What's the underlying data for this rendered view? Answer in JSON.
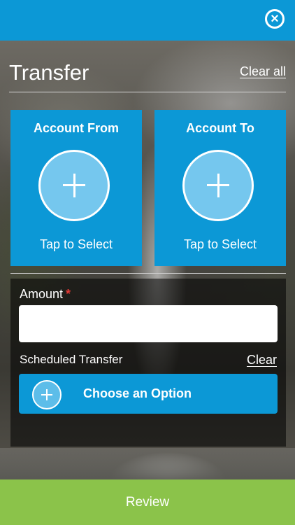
{
  "header": {
    "close_icon": "close-circle-icon",
    "accent_color": "#0c98d6"
  },
  "page": {
    "title": "Transfer",
    "clear_all_label": "Clear all"
  },
  "accounts": {
    "from": {
      "title": "Account From",
      "action": "Tap to Select",
      "icon": "plus-circle-icon"
    },
    "to": {
      "title": "Account To",
      "action": "Tap to Select",
      "icon": "plus-circle-icon"
    }
  },
  "form": {
    "amount_label": "Amount",
    "required_marker": "*",
    "amount_value": "",
    "scheduled_label": "Scheduled Transfer",
    "scheduled_clear_label": "Clear",
    "option_label": "Choose an Option",
    "option_icon": "plus-circle-icon"
  },
  "footer": {
    "review_label": "Review",
    "review_color": "#8bc34a"
  }
}
